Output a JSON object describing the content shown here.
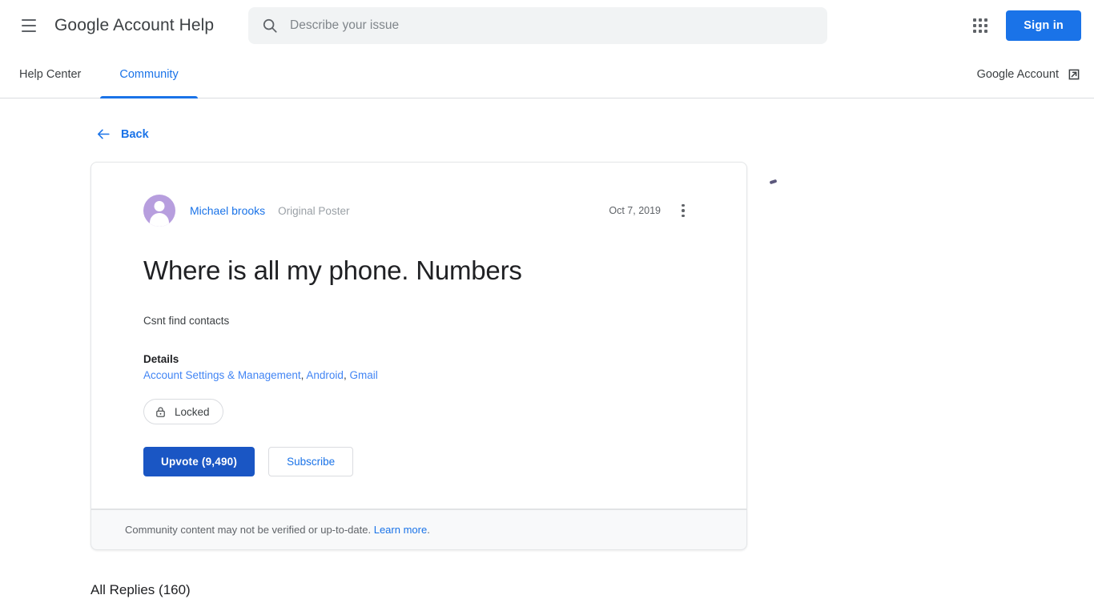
{
  "topbar": {
    "menu_icon": "hamburger-menu-icon",
    "product_title": "Google Account Help",
    "search": {
      "icon": "search-icon",
      "placeholder": "Describe your issue",
      "value": ""
    },
    "apps_icon": "apps-grid-icon",
    "signin_label": "Sign in",
    "accent_color": "#1a73e8"
  },
  "nav": {
    "tabs": [
      {
        "label": "Help Center",
        "active": false
      },
      {
        "label": "Community",
        "active": true
      }
    ],
    "right_link": {
      "label": "Google Account",
      "icon": "external-link-icon"
    }
  },
  "main": {
    "back": {
      "label": "Back",
      "icon": "arrow-left-icon"
    },
    "post": {
      "avatar_icon": "person-avatar-icon",
      "avatar_color": "#b79ede",
      "author": "Michael brooks",
      "op_badge": "Original Poster",
      "date": "Oct 7, 2019",
      "overflow_icon": "more-vert-icon",
      "title": "Where is all my phone. Numbers",
      "body": "Csnt find contacts",
      "details_label": "Details",
      "details_links": [
        "Account Settings & Management",
        "Android",
        "Gmail"
      ],
      "details_separator": ", ",
      "status_chip": {
        "icon": "lock-icon",
        "label": "Locked"
      },
      "upvote_label": "Upvote (9,490)",
      "upvote_count": "9,490",
      "subscribe_label": "Subscribe"
    },
    "card_footer": {
      "text": "Community content may not be verified or up-to-date.",
      "link_label": "Learn more",
      "trailing": "."
    },
    "replies_heading": "All Replies (160)",
    "replies_count": "160"
  }
}
